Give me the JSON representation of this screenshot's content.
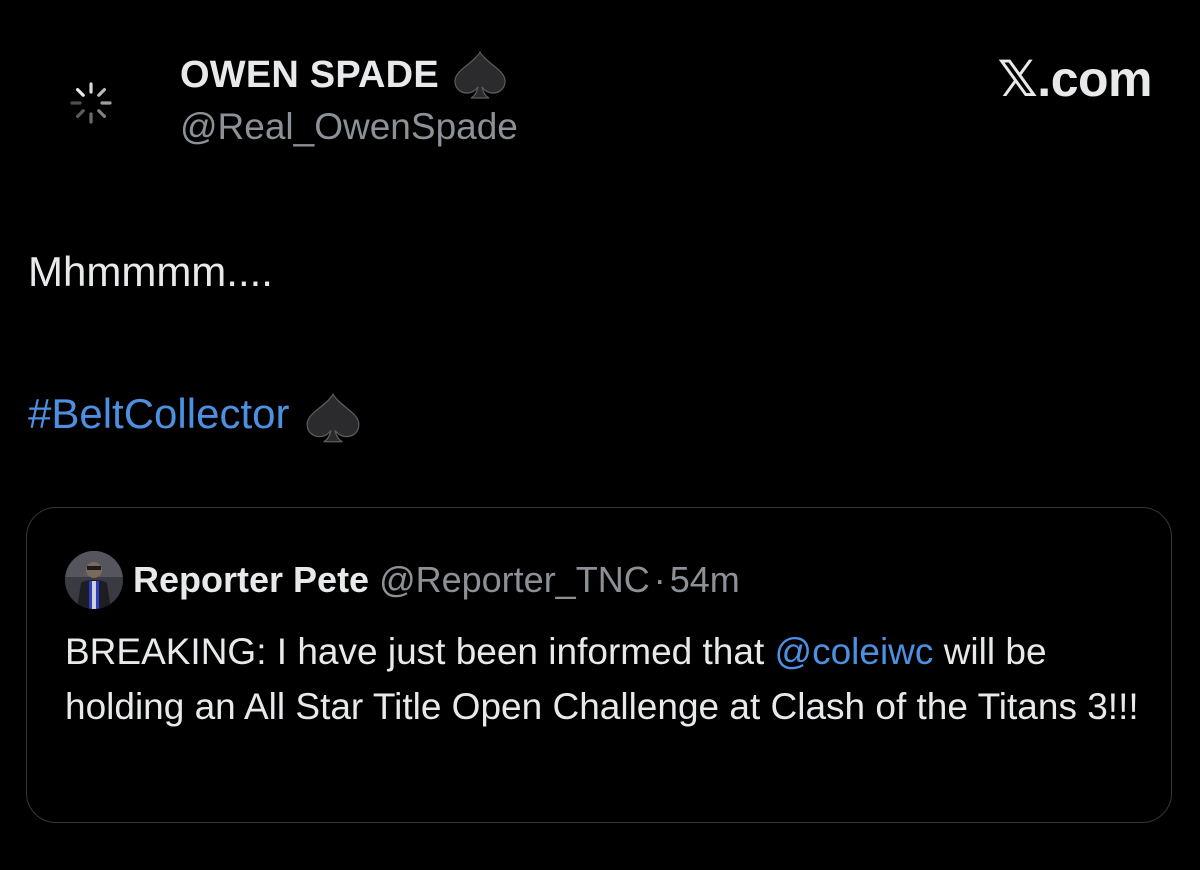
{
  "tweet": {
    "author": {
      "display_name": "OWEN SPADE",
      "handle": "@Real_OwenSpade",
      "avatar_icon": "loading-spinner-icon",
      "badge_icon": "spade-icon"
    },
    "site_label": "𝕏.com",
    "text_line1": "Mhmmmm....",
    "hashtag": "#BeltCollector",
    "hashtag_icon": "spade-icon"
  },
  "quote": {
    "display_name": "Reporter Pete",
    "handle": "@Reporter_TNC",
    "separator": "·",
    "time": "54m",
    "text_before_mention": "BREAKING: I have just been informed that ",
    "mention": "@coleiwc",
    "text_after_mention": " will be holding an All Star Title Open Challenge at Clash of the Titans 3!!!"
  },
  "colors": {
    "background": "#000000",
    "primary_text": "#e7e9ea",
    "secondary_text": "#8b9196",
    "link": "#4d8fe0",
    "card_border": "#33373b"
  }
}
